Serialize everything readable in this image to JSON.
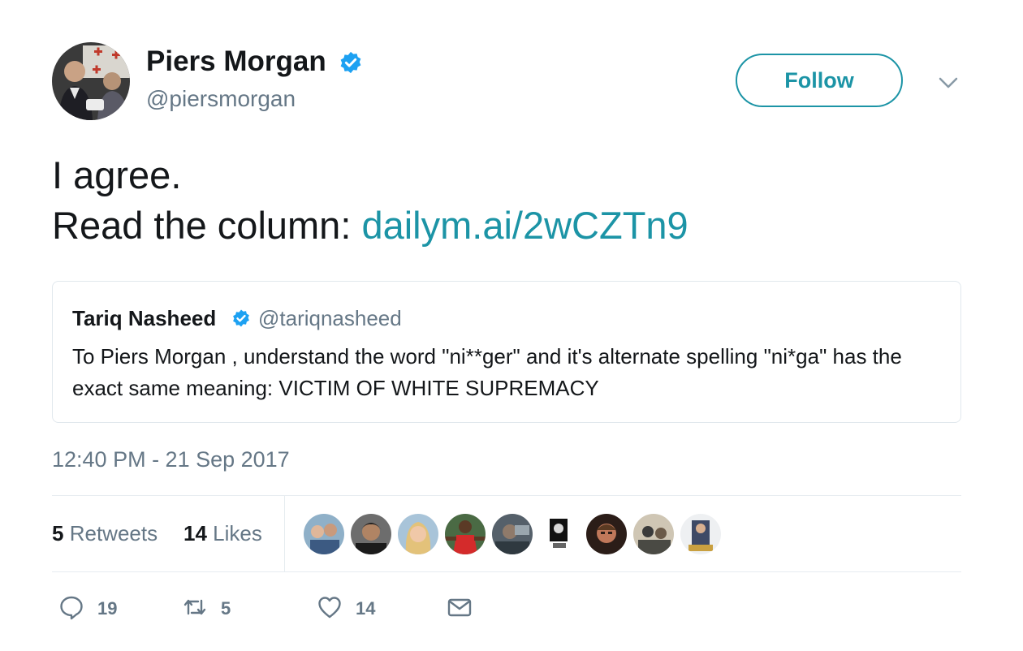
{
  "author": {
    "name": "Piers Morgan",
    "handle": "@piersmorgan",
    "verified": true
  },
  "follow_label": "Follow",
  "tweet": {
    "line1": "I agree.",
    "line2_prefix": "Read the column: ",
    "link_text": "dailym.ai/2wCZTn9"
  },
  "quote": {
    "name": "Tariq Nasheed",
    "handle": "@tariqnasheed",
    "verified": true,
    "text": "To Piers Morgan , understand the word \"ni**ger\" and it's alternate spelling \"ni*ga\" has the exact same meaning: VICTIM OF WHITE SUPREMACY"
  },
  "timestamp": "12:40 PM - 21 Sep 2017",
  "stats": {
    "retweets_count": "5",
    "retweets_label": "Retweets",
    "likes_count": "14",
    "likes_label": "Likes"
  },
  "actions": {
    "reply_count": "19",
    "retweet_count": "5",
    "like_count": "14"
  },
  "icons": [
    "verified-icon",
    "chevron-down-icon",
    "reply-icon",
    "retweet-icon",
    "heart-icon",
    "mail-icon"
  ],
  "colors": {
    "accent": "#1c94a6",
    "verified": "#1da1f2",
    "secondary_text": "#657786",
    "border": "#e1e8ed"
  }
}
